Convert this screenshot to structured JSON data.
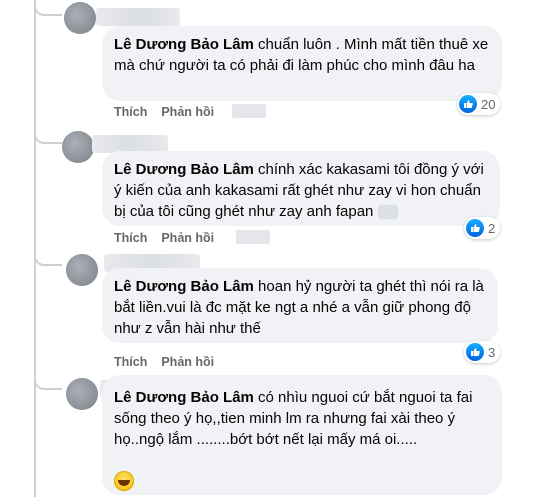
{
  "comments": [
    {
      "author": "Lê Dương Bảo Lâm",
      "text": "chuẩn luôn . Mình mất tiền thuê xe mà chứ người ta có phải đi làm phúc cho mình đâu ha",
      "actions": {
        "like": "Thích",
        "reply": "Phản hồi"
      },
      "reaction": {
        "type": "like",
        "count": "20"
      }
    },
    {
      "author": "Lê Dương Bảo Lâm",
      "text": "chính xác kakasami tôi đồng ý với ý kiến của anh kakasami rất ghét như zay vi hon chuẩn bị của tôi cũng ghét như zay anh fapan",
      "actions": {
        "like": "Thích",
        "reply": "Phản hồi"
      },
      "reaction": {
        "type": "like",
        "count": "2"
      }
    },
    {
      "author": "Lê Dương Bảo Lâm",
      "text": "hoan hỷ người ta ghét thì nói ra là bắt liền.vui là đc mặt ke ngt a nhé a vẫn giữ phong độ như z vẫn hài như thế",
      "actions": {
        "like": "Thích",
        "reply": "Phản hồi"
      },
      "reaction": {
        "type": "like",
        "count": "3"
      }
    },
    {
      "author": "Lê Dương Bảo Lâm",
      "text": "có nhìu nguoi cứ bắt nguoi ta fai sống theo ý họ,,tien minh lm ra nhưng fai xài theo ý họ..ngộ lắm ........bớt bớt nết lại mấy má oi.....",
      "reaction": {
        "type": "haha"
      }
    }
  ],
  "colors": {
    "bubble": "#f0f2f5",
    "like": "#0866ff",
    "muted": "#65676b"
  }
}
